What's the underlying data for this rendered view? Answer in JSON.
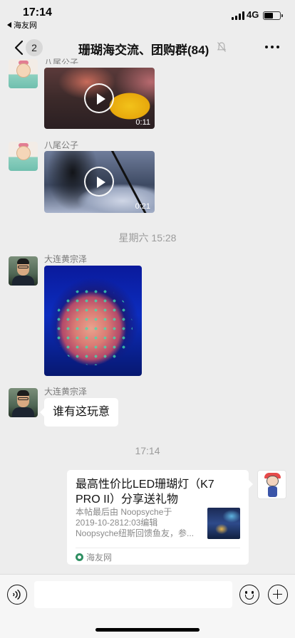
{
  "status_bar": {
    "time": "17:14",
    "back_app": "海友网",
    "network": "4G",
    "battery_level": 0.55
  },
  "nav": {
    "unread_count": "2",
    "title": "珊瑚海交流、团购群(84)"
  },
  "messages": {
    "top_partial": {
      "sender": "八尾公子",
      "type": "video",
      "duration": "0:11"
    },
    "video_2": {
      "sender": "八尾公子",
      "type": "video",
      "duration": "0:21"
    },
    "timestamp_1": "星期六 15:28",
    "image_msg": {
      "sender": "大连黄宗泽",
      "type": "image"
    },
    "text_msg": {
      "sender": "大连黄宗泽",
      "text": "谁有这玩意"
    },
    "timestamp_2": "17:14",
    "link_card": {
      "title_line1": "最高性价比LED珊瑚灯（K7",
      "title_line2": "PRO II）分享送礼物",
      "desc_line1": "本帖最后由 Noopsyche于",
      "desc_line2": "2019-10-2812:03编辑",
      "desc_line3": "Noopsyche纽斯回馈鱼友，参...",
      "source": "海友网"
    }
  },
  "input_bar": {
    "placeholder": ""
  },
  "icons": {
    "back": "chevron-left-icon",
    "mute": "bell-slash-icon",
    "more": "ellipsis-icon",
    "voice": "voice-icon",
    "emoji": "emoji-icon",
    "plus": "plus-icon",
    "play": "play-icon"
  }
}
